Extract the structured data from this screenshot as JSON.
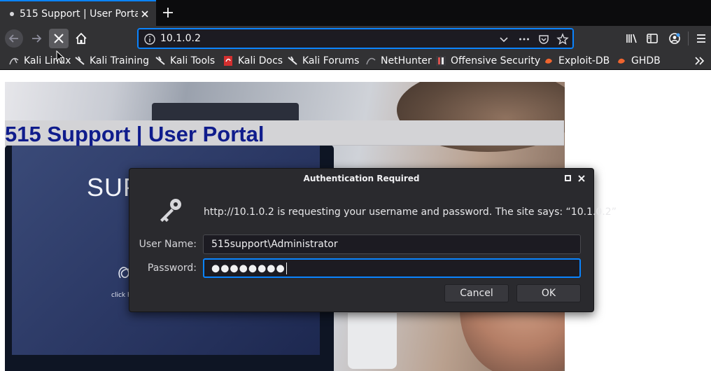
{
  "tab": {
    "title": "515 Support | User Portal"
  },
  "navbar": {
    "url": "10.1.0.2"
  },
  "bookmarks": [
    {
      "label": "Kali Linux",
      "icon": "kali-dragon-icon"
    },
    {
      "label": "Kali Training",
      "icon": "kali-dragon-icon"
    },
    {
      "label": "Kali Tools",
      "icon": "kali-dragon-icon"
    },
    {
      "label": "Kali Docs",
      "icon": "kali-docs-icon"
    },
    {
      "label": "Kali Forums",
      "icon": "kali-dragon-icon"
    },
    {
      "label": "NetHunter",
      "icon": "nethunter-icon"
    },
    {
      "label": "Offensive Security",
      "icon": "offsec-icon"
    },
    {
      "label": "Exploit-DB",
      "icon": "exploitdb-icon"
    },
    {
      "label": "GHDB",
      "icon": "ghdb-icon"
    }
  ],
  "page": {
    "title": "515 Support | User Portal",
    "hero_screen_text": "SUPP",
    "hero_small_text": "click h"
  },
  "dialog": {
    "title": "Authentication Required",
    "message": "http://10.1.0.2 is requesting your username and password. The site says: “10.1.0.2”",
    "username_label": "User Name:",
    "username_value": "515support\\Administrator",
    "password_label": "Password:",
    "password_dots": "●●●●●●●●",
    "cancel_label": "Cancel",
    "ok_label": "OK"
  },
  "colors": {
    "accent": "#0a84ff",
    "chrome": "#323234",
    "dialog": "#2a2a2e",
    "page_title": "#0f1c8c"
  }
}
